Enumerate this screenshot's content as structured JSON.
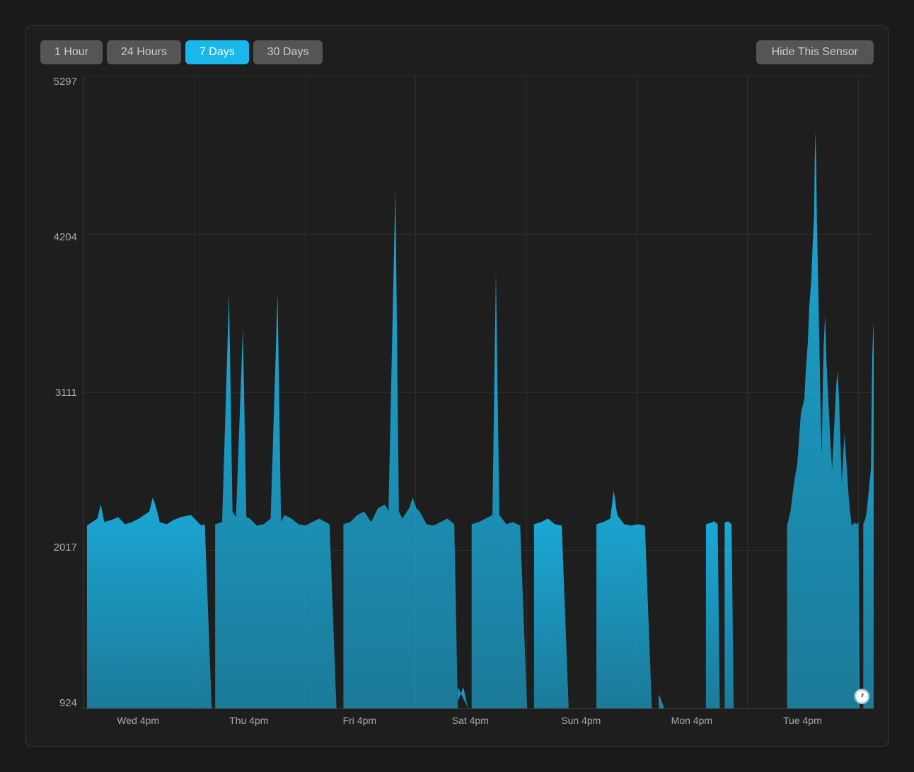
{
  "toolbar": {
    "buttons": [
      {
        "label": "1 Hour",
        "active": false
      },
      {
        "label": "24 Hours",
        "active": false
      },
      {
        "label": "7 Days",
        "active": true
      },
      {
        "label": "30 Days",
        "active": false
      }
    ],
    "hide_label": "Hide This Sensor"
  },
  "chart": {
    "y_labels": [
      "5297",
      "4204",
      "3111",
      "2017",
      "924"
    ],
    "x_labels": [
      {
        "text": "Wed 4pm",
        "pct": 7
      },
      {
        "text": "Thu 4pm",
        "pct": 21
      },
      {
        "text": "Fri 4pm",
        "pct": 35
      },
      {
        "text": "Sat 4pm",
        "pct": 49
      },
      {
        "text": "Sun 4pm",
        "pct": 63
      },
      {
        "text": "Mon 4pm",
        "pct": 77
      },
      {
        "text": "Tue 4pm",
        "pct": 91
      }
    ],
    "grid_h_pcts": [
      0,
      25,
      50,
      75,
      100
    ],
    "grid_v_pcts": [
      14,
      28,
      42,
      56,
      70,
      84,
      98
    ]
  },
  "colors": {
    "accent": "#1ab7ea",
    "bg": "#1e1e1e",
    "grid": "#2e2e2e",
    "text": "#aaa",
    "btn_bg": "#555",
    "active_btn": "#1ab7ea"
  }
}
